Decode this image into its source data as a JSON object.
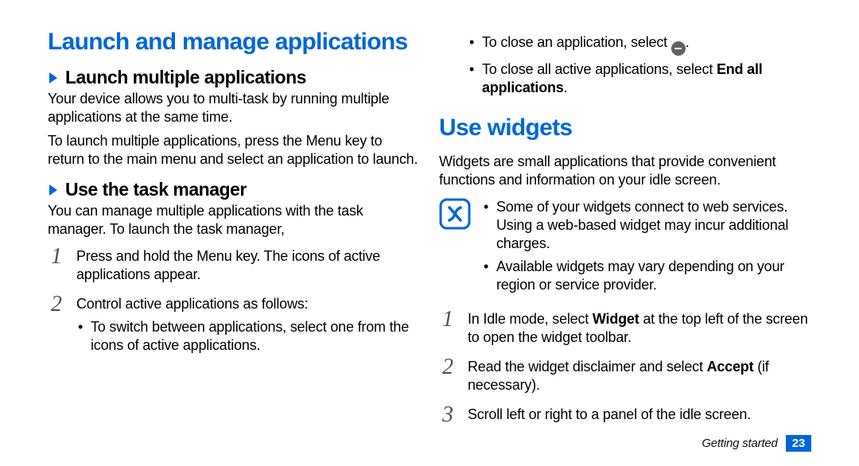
{
  "left": {
    "heading1": "Launch and manage applications",
    "sec1_heading": "Launch multiple applications",
    "sec1_p1": "Your device allows you to multi-task by running multiple applications at the same time.",
    "sec1_p2": "To launch multiple applications, press the Menu key to return to the main menu and select an application to launch.",
    "sec2_heading": "Use the task manager",
    "sec2_p1": "You can manage multiple applications with the task manager. To launch the task manager,",
    "sec2_step1": "Press and hold the Menu key. The icons of active applications appear.",
    "sec2_step2": "Control active applications as follows:",
    "sec2_b1": "To switch between applications, select one from the icons of active applications."
  },
  "right": {
    "top_b1_a": "To close an application, select ",
    "top_b1_b": ".",
    "top_b2_a": "To close all active applications, select ",
    "top_b2_bold": "End all applications",
    "top_b2_b": ".",
    "heading1": "Use widgets",
    "intro": "Widgets are small applications that provide convenient functions and information on your idle screen.",
    "note_b1": "Some of your widgets connect to web services. Using a web-based widget may incur additional charges.",
    "note_b2": "Available widgets may vary depending on your region or service provider.",
    "step1_a": "In Idle mode, select ",
    "step1_bold": "Widget",
    "step1_b": " at the top left of the screen to open the widget toolbar.",
    "step2_a": "Read the widget disclaimer and select ",
    "step2_bold": "Accept",
    "step2_b": " (if necessary).",
    "step3": "Scroll left or right to a panel of the idle screen."
  },
  "footer": {
    "section": "Getting started",
    "page": "23"
  }
}
